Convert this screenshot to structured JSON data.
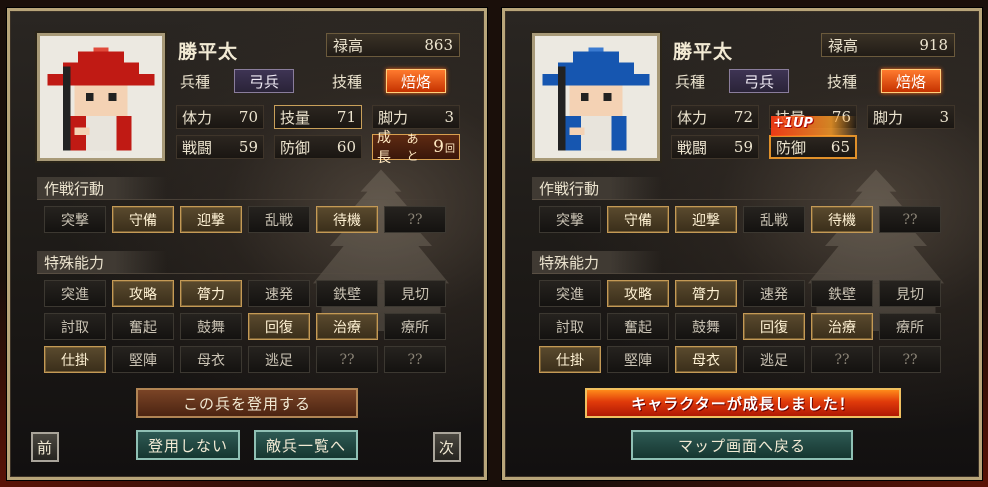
{
  "left": {
    "name": "勝平太",
    "salary": {
      "label": "禄高",
      "value": "863"
    },
    "unit_type": {
      "label": "兵種",
      "value": "弓兵"
    },
    "skill": {
      "label": "技種",
      "value": "焙烙"
    },
    "stats": [
      {
        "label": "体力",
        "value": "70"
      },
      {
        "label": "技量",
        "value": "71"
      },
      {
        "label": "脚力",
        "value": "3"
      },
      {
        "label": "戦闘",
        "value": "59"
      },
      {
        "label": "防御",
        "value": "60"
      }
    ],
    "growth": {
      "label": "成長",
      "prefix": "あと",
      "value": "9",
      "suffix": "回"
    },
    "tactics_title": "作戦行動",
    "tactics": [
      {
        "label": "突撃",
        "on": false
      },
      {
        "label": "守備",
        "on": true
      },
      {
        "label": "迎撃",
        "on": true
      },
      {
        "label": "乱戦",
        "on": false
      },
      {
        "label": "待機",
        "on": true
      },
      {
        "label": "??",
        "on": false
      }
    ],
    "abilities_title": "特殊能力",
    "abilities": [
      {
        "label": "突進",
        "on": false
      },
      {
        "label": "攻略",
        "on": true
      },
      {
        "label": "膂力",
        "on": true
      },
      {
        "label": "速発",
        "on": false
      },
      {
        "label": "鉄壁",
        "on": false
      },
      {
        "label": "見切",
        "on": false
      },
      {
        "label": "討取",
        "on": false
      },
      {
        "label": "奮起",
        "on": false
      },
      {
        "label": "鼓舞",
        "on": false
      },
      {
        "label": "回復",
        "on": true
      },
      {
        "label": "治療",
        "on": true
      },
      {
        "label": "療所",
        "on": false
      },
      {
        "label": "仕掛",
        "on": true
      },
      {
        "label": "堅陣",
        "on": false
      },
      {
        "label": "母衣",
        "on": false
      },
      {
        "label": "逃足",
        "on": false
      },
      {
        "label": "??",
        "on": false
      },
      {
        "label": "??",
        "on": false
      }
    ],
    "recruit_button": "この兵を登用する",
    "prev_button": "前",
    "decline_button": "登用しない",
    "enemy_list_button": "敵兵一覧へ",
    "next_button": "次"
  },
  "right": {
    "name": "勝平太",
    "salary": {
      "label": "禄高",
      "value": "918"
    },
    "unit_type": {
      "label": "兵種",
      "value": "弓兵"
    },
    "skill": {
      "label": "技種",
      "value": "焙烙"
    },
    "stats": [
      {
        "label": "体力",
        "value": "72"
      },
      {
        "label": "技量",
        "value": "76"
      },
      {
        "label": "脚力",
        "value": "3"
      },
      {
        "label": "戦闘",
        "value": "59"
      },
      {
        "label": "防御",
        "value": "65"
      }
    ],
    "levelup_text": "+1UP",
    "tactics_title": "作戦行動",
    "tactics": [
      {
        "label": "突撃",
        "on": false
      },
      {
        "label": "守備",
        "on": true
      },
      {
        "label": "迎撃",
        "on": true
      },
      {
        "label": "乱戦",
        "on": false
      },
      {
        "label": "待機",
        "on": true
      },
      {
        "label": "??",
        "on": false
      }
    ],
    "abilities_title": "特殊能力",
    "abilities": [
      {
        "label": "突進",
        "on": false
      },
      {
        "label": "攻略",
        "on": true
      },
      {
        "label": "膂力",
        "on": true
      },
      {
        "label": "速発",
        "on": false
      },
      {
        "label": "鉄壁",
        "on": false
      },
      {
        "label": "見切",
        "on": false
      },
      {
        "label": "討取",
        "on": false
      },
      {
        "label": "奮起",
        "on": false
      },
      {
        "label": "鼓舞",
        "on": false
      },
      {
        "label": "回復",
        "on": true
      },
      {
        "label": "治療",
        "on": true
      },
      {
        "label": "療所",
        "on": false
      },
      {
        "label": "仕掛",
        "on": true
      },
      {
        "label": "堅陣",
        "on": false
      },
      {
        "label": "母衣",
        "on": true
      },
      {
        "label": "逃足",
        "on": false
      },
      {
        "label": "??",
        "on": false
      },
      {
        "label": "??",
        "on": false
      }
    ],
    "growth_banner": "キャラクターが成長しました！",
    "map_button": "マップ画面へ戻る"
  },
  "colors": {
    "hat_left": "#c01a14",
    "hat_right": "#1656b0",
    "accent_on": "#c49a56"
  }
}
